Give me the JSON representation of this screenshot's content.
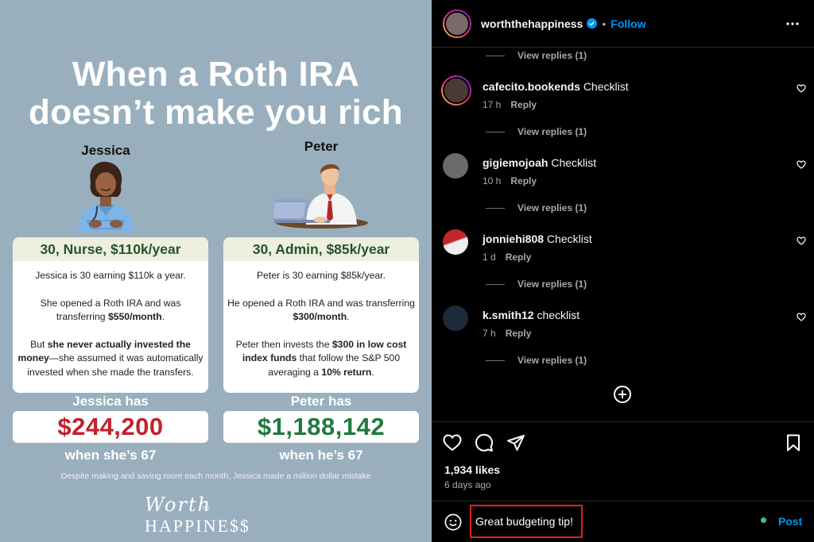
{
  "post": {
    "title_line1": "When a Roth IRA",
    "title_line2": "doesn’t make you rich",
    "caption": "Despite making and saving more each month, Jessica made a million dollar mistake",
    "logo_script": "Worth",
    "logo_the": "THE",
    "logo_main": "HAPPINE$$",
    "jessica": {
      "name": "Jessica",
      "headline": "30, Nurse, $110k/year",
      "p1": "Jessica is 30 earning $110k a year.",
      "p2_a": "She opened a Roth IRA and was transferring ",
      "p2_b": "$550/month",
      "p2_c": ".",
      "p3_a": "But ",
      "p3_b": "she never actually invested the money",
      "p3_c": "—she assumed it was automatically invested when she made the transfers.",
      "has_label": "Jessica has",
      "amount": "$244,200",
      "when": "when she’s 67"
    },
    "peter": {
      "name": "Peter",
      "headline": "30, Admin, $85k/year",
      "p1": "Peter is 30 earning $85k/year.",
      "p2_a": "He opened a Roth IRA and was transferring ",
      "p2_b": "$300/month",
      "p2_c": ".",
      "p3_a": "Peter then invests the ",
      "p3_b": "$300 in low cost index funds",
      "p3_c": " that follow the S&P 500 averaging a ",
      "p3_d": "10% return",
      "p3_e": ".",
      "has_label": "Peter has",
      "amount": "$1,188,142",
      "when": "when he’s 67"
    },
    "colors": {
      "background": "#9aafbe",
      "jessica_amount": "#c3212b",
      "peter_amount": "#1f7a3c",
      "headline": "#26522f"
    }
  },
  "panel": {
    "header": {
      "username": "worththehappiness",
      "dot": "•",
      "follow_label": "Follow",
      "verified_icon": "verified-badge-icon",
      "more_icon": "more-horizontal-icon"
    },
    "view_replies_label": "View replies (1)",
    "comments": [
      {
        "username": "cafecito.bookends",
        "text": "Checklist",
        "time": "17 h",
        "reply_label": "Reply"
      },
      {
        "username": "gigiemojoah",
        "text": "Checklist",
        "time": "10 h",
        "reply_label": "Reply"
      },
      {
        "username": "jonniehi808",
        "text": "Checklist",
        "time": "1 d",
        "reply_label": "Reply"
      },
      {
        "username": "k.smith12",
        "text": "checklist",
        "time": "7 h",
        "reply_label": "Reply"
      }
    ],
    "likes": "1,934 likes",
    "posted": "6 days ago",
    "composer": {
      "value": "Great budgeting tip!",
      "post_label": "Post"
    },
    "colors": {
      "link": "#0095f6",
      "muted": "#a8a8a8",
      "highlight_border": "#e0241b"
    }
  }
}
